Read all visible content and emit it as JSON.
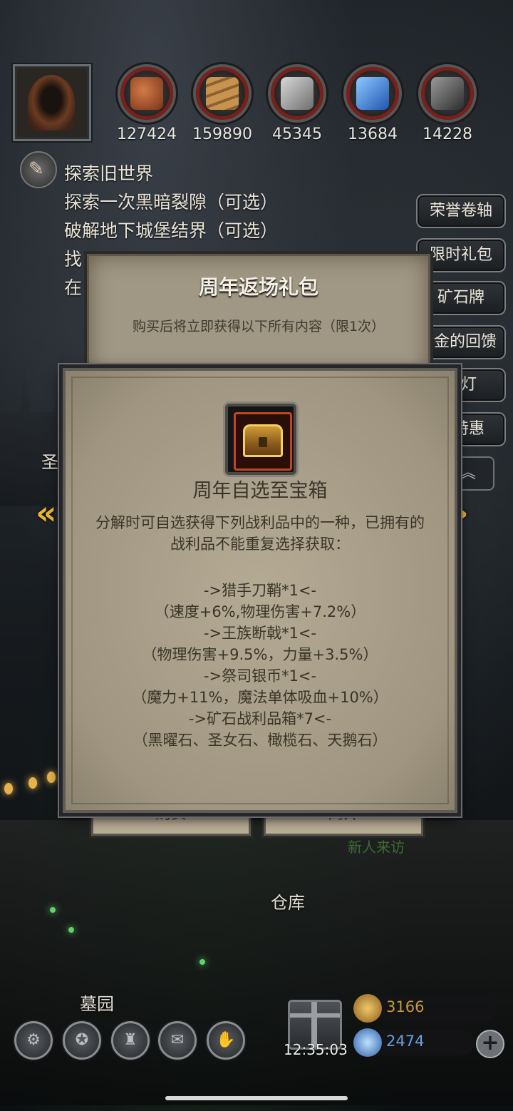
{
  "resources": [
    {
      "name": "meat",
      "value": "127424",
      "color": "#b0562a"
    },
    {
      "name": "wood",
      "value": "159890",
      "color": "#9a7040"
    },
    {
      "name": "iron",
      "value": "45345",
      "color": "#9a9a9a"
    },
    {
      "name": "crystal",
      "value": "13684",
      "color": "#3a7fd6"
    },
    {
      "name": "ore",
      "value": "14228",
      "color": "#6a6a6a"
    }
  ],
  "quests": [
    "探索旧世界",
    "探索一次黑暗裂隙（可选）",
    "破解地下城堡结界（可选）",
    "找",
    "在"
  ],
  "side_buttons": [
    "荣誉卷轴",
    "限时礼包",
    "矿石牌",
    "犀金的回馈",
    "愿灯",
    "年特惠"
  ],
  "back_panel": {
    "title": "周年返场礼包",
    "subtitle": "购买后将立即获得以下所有内容（限1次）",
    "buy_label": "购买",
    "close_label": "离开"
  },
  "item_panel": {
    "item_name": "周年自选至宝箱",
    "description": "分解时可自选获得下列战利品中的一种，已拥有的战利品不能重复选择获取：",
    "rewards": [
      "->猎手刀鞘*1<-",
      "（速度+6%,物理伤害+7.2%）",
      "->王族断戟*1<-",
      "（物理伤害+9.5%，力量+3.5%）",
      "->祭司银币*1<-",
      "（魔力+11%，魔法单体吸血+10%）",
      "->矿石战利品箱*7<-",
      "（黑曜石、圣女石、橄榄石、天鹅石）"
    ]
  },
  "map_labels": {
    "sage": "圣",
    "warehouse": "仓库",
    "graveyard": "墓园",
    "visitor": "新人来访"
  },
  "bottom": {
    "icons": [
      "gear-icon",
      "star-badge-icon",
      "castle-icon",
      "mail-icon",
      "handshake-icon"
    ],
    "timer": "12:35:03",
    "gold": "3166",
    "gems": "2474",
    "gold_color": "#c79a3a",
    "gem_color": "#6aa0d8"
  }
}
